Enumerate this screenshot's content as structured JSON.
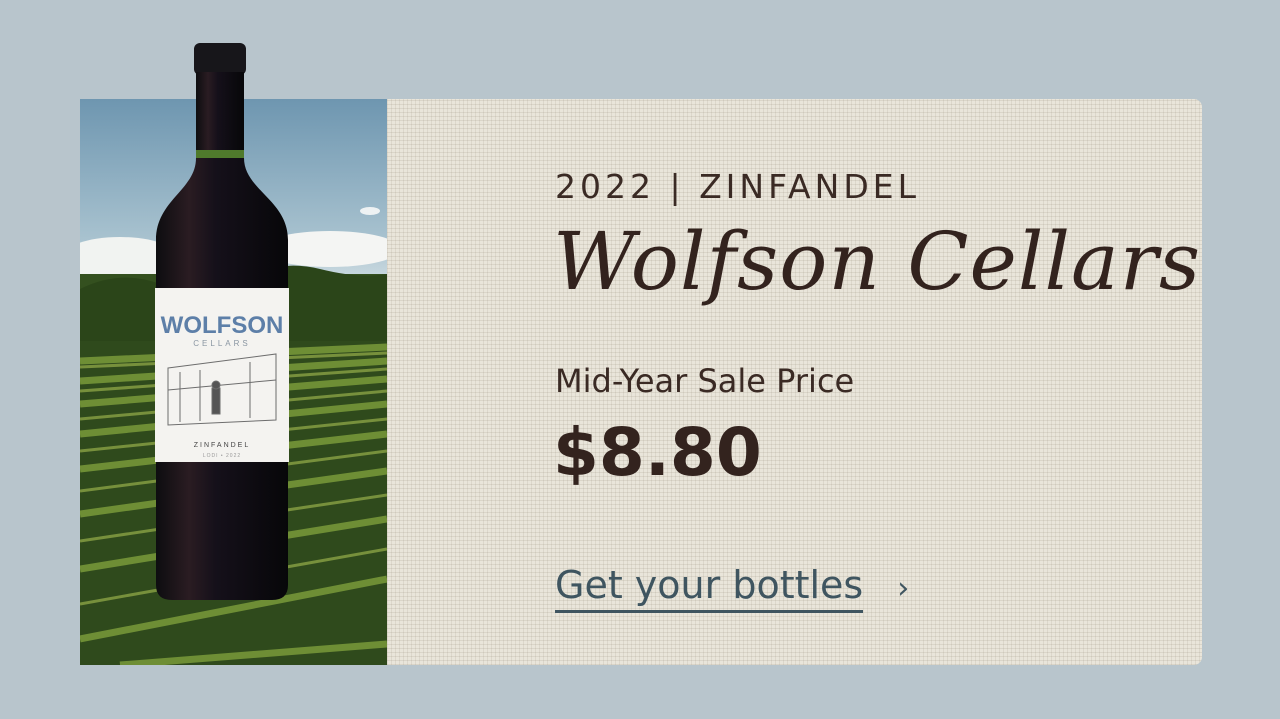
{
  "promo": {
    "eyebrow": "2022 | ZINFANDEL",
    "brand": "Wolfson Cellars",
    "sale_label": "Mid-Year Sale Price",
    "price": "$8.80",
    "cta_label": "Get your bottles",
    "cta_arrow": "›"
  },
  "label": {
    "brand_top": "WOLFSON",
    "brand_sub": "CELLARS",
    "varietal": "ZINFANDEL",
    "detail": "LODI • 2022"
  },
  "icons": {
    "cta": "chevron-right-icon"
  },
  "colors": {
    "page_background": "#b8c5cc",
    "panel_background": "#e9e5da",
    "text_dark": "#33231e",
    "cta_color": "#3f5560",
    "label_blue": "#5d7fa8"
  }
}
